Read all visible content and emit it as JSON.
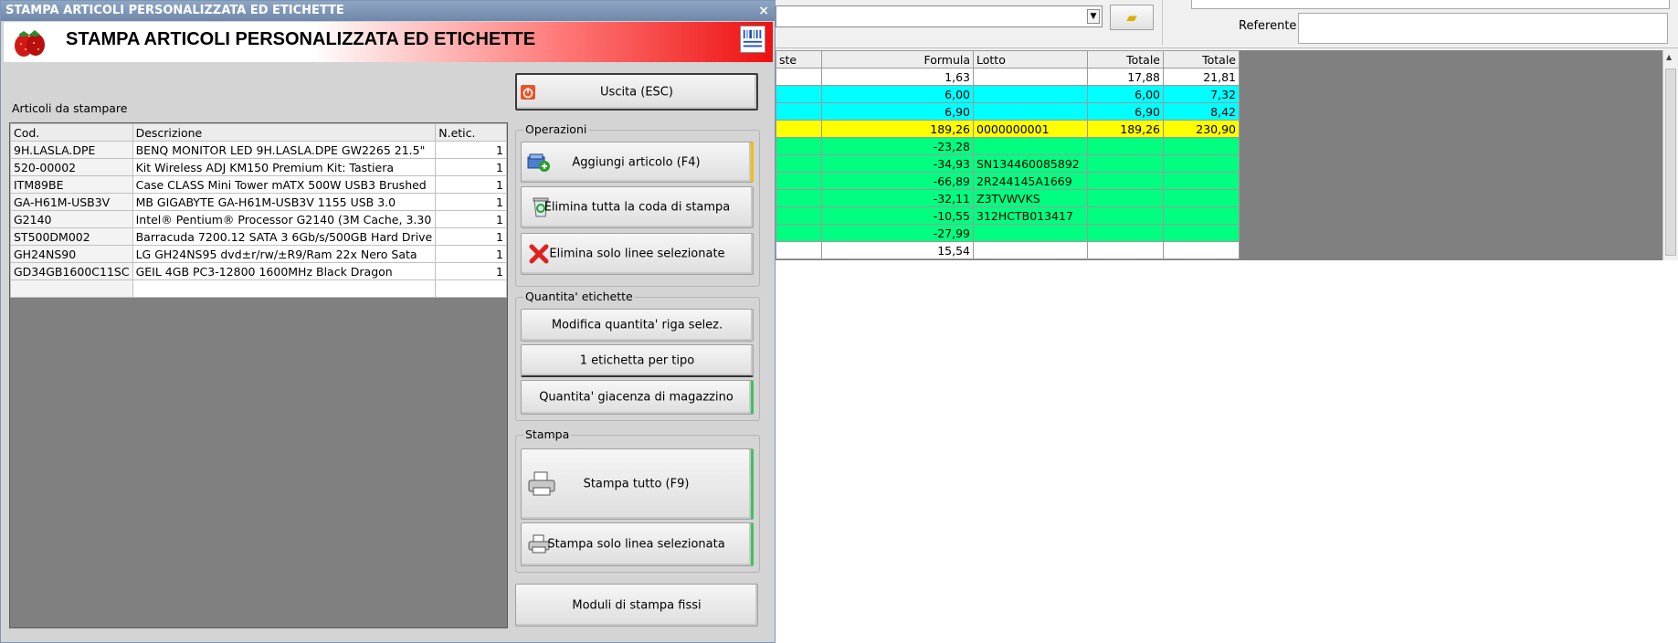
{
  "window": {
    "title": "STAMPA ARTICOLI PERSONALIZZATA ED ETICHETTE",
    "close_label": "×"
  },
  "banner": {
    "title": "STAMPA ARTICOLI PERSONALIZZATA ED ETICHETTE"
  },
  "list": {
    "label": "Articoli da stampare",
    "columns": [
      "Cod.",
      "Descrizione",
      "N.etic."
    ],
    "rows": [
      {
        "code": "9H.LASLA.DPE",
        "desc": "BENQ MONITOR LED 9H.LASLA.DPE GW2265 21.5\"",
        "qty": "1"
      },
      {
        "code": "520-00002",
        "desc": "Kit Wireless ADJ KM150 Premium Kit: Tastiera",
        "qty": "1"
      },
      {
        "code": "ITM89BE",
        "desc": "Case CLASS Mini Tower mATX 500W USB3 Brushed",
        "qty": "1"
      },
      {
        "code": "GA-H61M-USB3V",
        "desc": "MB GIGABYTE GA-H61M-USB3V 1155 USB 3.0",
        "qty": "1"
      },
      {
        "code": "G2140",
        "desc": "Intel® Pentium® Processor G2140 (3M Cache, 3.30",
        "qty": "1"
      },
      {
        "code": "ST500DM002",
        "desc": "Barracuda 7200.12 SATA 3 6Gb/s/500GB Hard Drive",
        "qty": "1"
      },
      {
        "code": "GH24NS90",
        "desc": "LG GH24NS95 dvd±r/rw/±R9/Ram 22x Nero Sata",
        "qty": "1"
      },
      {
        "code": "GD34GB1600C11SC",
        "desc": "GEIL 4GB PC3-12800 1600MHz Black Dragon",
        "qty": "1"
      },
      {
        "code": "",
        "desc": "",
        "qty": ""
      }
    ]
  },
  "buttons": {
    "exit": "Uscita (ESC)",
    "add": "Aggiungi articolo (F4)",
    "clear_queue": "Elimina tutta la coda di stampa",
    "delete_selected": "Elimina solo linee selezionate",
    "modify_qty": "Modifica quantita' riga selez.",
    "one_per_type": "1 etichetta per tipo",
    "stock_qty": "Quantita' giacenza di magazzino",
    "print_all": "Stampa tutto (F9)",
    "print_selected": "Stampa solo linea selezionata",
    "fixed_modules": "Moduli di stampa fissi"
  },
  "groups": {
    "operations": "Operazioni",
    "label_qty": "Quantita' etichette",
    "print": "Stampa"
  },
  "background": {
    "referente_label": "Referente",
    "grid_columns": [
      "ste",
      "Formula",
      "Lotto",
      "Totale",
      "Totale"
    ],
    "grid_rows": [
      {
        "color": "white",
        "c0": "",
        "formula": "1,63",
        "lotto": "",
        "tot1": "17,88",
        "tot2": "21,81"
      },
      {
        "color": "cyan",
        "c0": "",
        "formula": "6,00",
        "lotto": "",
        "tot1": "6,00",
        "tot2": "7,32"
      },
      {
        "color": "cyan",
        "c0": "",
        "formula": "6,90",
        "lotto": "",
        "tot1": "6,90",
        "tot2": "8,42"
      },
      {
        "color": "yellow",
        "c0": "",
        "formula": "189,26",
        "lotto": "0000000001",
        "tot1": "189,26",
        "tot2": "230,90"
      },
      {
        "color": "green",
        "c0": "",
        "formula": "-23,28",
        "lotto": "",
        "tot1": "",
        "tot2": ""
      },
      {
        "color": "green",
        "c0": "",
        "formula": "-34,93",
        "lotto": "SN134460085892",
        "tot1": "",
        "tot2": ""
      },
      {
        "color": "green",
        "c0": "",
        "formula": "-66,89",
        "lotto": "2R244145A1669",
        "tot1": "",
        "tot2": ""
      },
      {
        "color": "green",
        "c0": "",
        "formula": "-32,11",
        "lotto": "Z3TVWVKS",
        "tot1": "",
        "tot2": ""
      },
      {
        "color": "green",
        "c0": "",
        "formula": "-10,55",
        "lotto": "312HCTB013417",
        "tot1": "",
        "tot2": ""
      },
      {
        "color": "green",
        "c0": "",
        "formula": "-27,99",
        "lotto": "",
        "tot1": "",
        "tot2": ""
      },
      {
        "color": "white",
        "c0": "",
        "formula": "15,54",
        "lotto": "",
        "tot1": "",
        "tot2": ""
      }
    ]
  },
  "icons": {
    "exit": "power-icon",
    "add": "add-box-icon",
    "clear_queue": "recycle-bin-icon",
    "delete_selected": "red-x-icon",
    "print_all": "printer-icon",
    "print_selected": "printer-small-icon",
    "banner_logo": "strawberry-icon",
    "banner_right": "barcode-icon",
    "folder": "folder-icon"
  }
}
